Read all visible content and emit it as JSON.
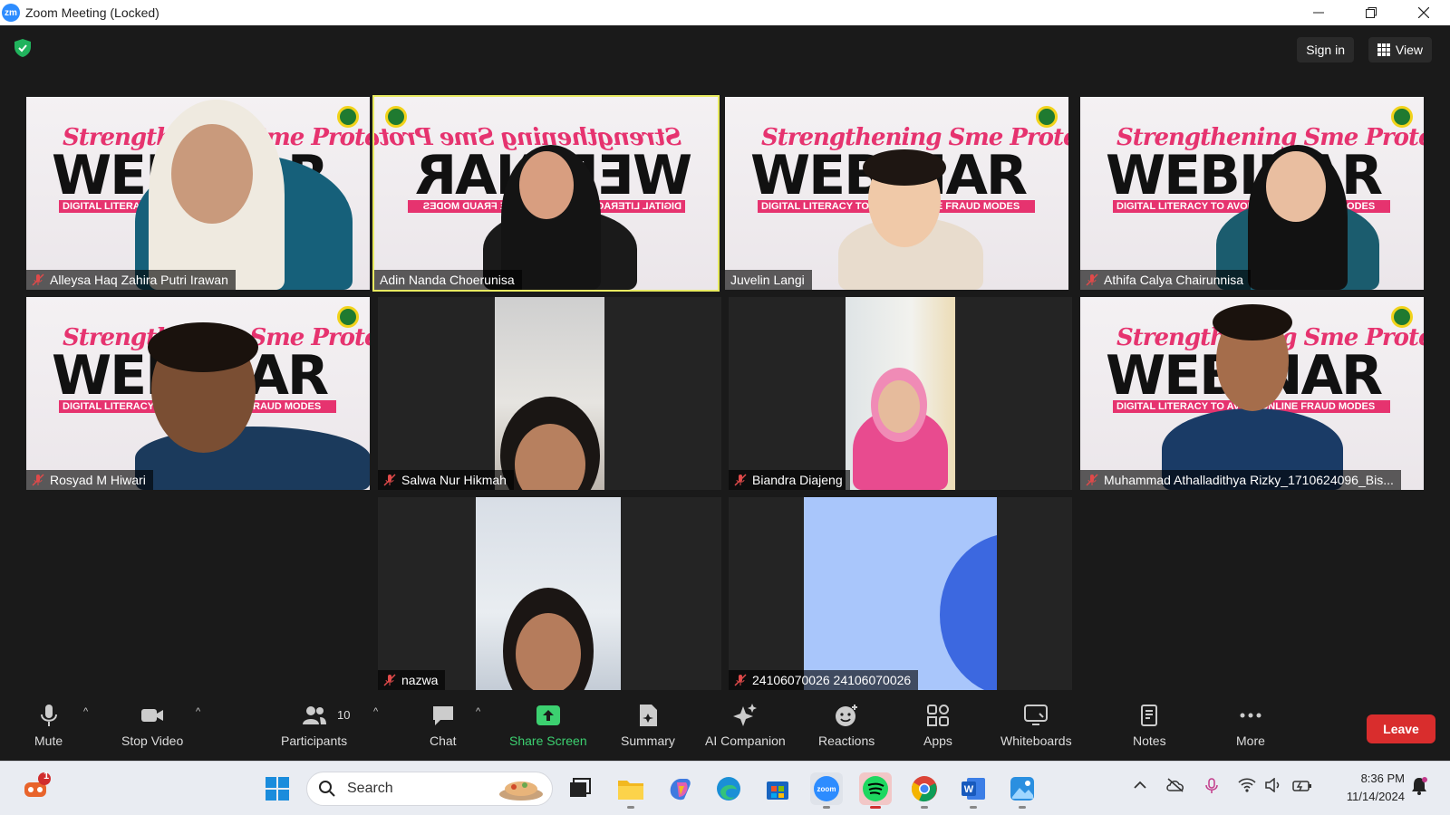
{
  "window": {
    "title": "Zoom Meeting (Locked)",
    "app_badge": "zm"
  },
  "topbar": {
    "sign_in": "Sign in",
    "view": "View"
  },
  "slide": {
    "script": "Strengthening Sme Protection",
    "big": "WEBINAR",
    "band": "DIGITAL LITERACY TO AVOID ONLINE FRAUD MODES"
  },
  "participants": [
    {
      "name": "Alleysa Haq Zahira Putri Irawan",
      "muted": true,
      "active": false
    },
    {
      "name": "Adin Nanda Choerunisa",
      "muted": false,
      "active": true
    },
    {
      "name": "Juvelin Langi",
      "muted": false,
      "active": false
    },
    {
      "name": "Athifa Calya Chairunnisa",
      "muted": true,
      "active": false
    },
    {
      "name": "Rosyad M Hiwari",
      "muted": true,
      "active": false
    },
    {
      "name": "Salwa Nur Hikmah",
      "muted": true,
      "active": false
    },
    {
      "name": "Biandra Diajeng",
      "muted": true,
      "active": false
    },
    {
      "name": "Muhammad Athalladithya Rizky_1710624096_Bis...",
      "muted": true,
      "active": false
    },
    {
      "name": "nazwa",
      "muted": true,
      "active": false
    },
    {
      "name": "24106070026 24106070026",
      "muted": true,
      "active": false
    }
  ],
  "toolbar": {
    "mute": "Mute",
    "stop_video": "Stop Video",
    "participants": "Participants",
    "participant_count": "10",
    "chat": "Chat",
    "share_screen": "Share Screen",
    "summary": "Summary",
    "ai_companion": "AI Companion",
    "reactions": "Reactions",
    "apps": "Apps",
    "whiteboards": "Whiteboards",
    "notes": "Notes",
    "more": "More",
    "leave": "Leave"
  },
  "taskbar": {
    "search_placeholder": "Search",
    "notification_badge": "1",
    "time": "8:36 PM",
    "date": "11/14/2024"
  },
  "colors": {
    "active_speaker": "#e8ea60",
    "share_green": "#3cd070",
    "leave_red": "#d92d2d",
    "slide_pink": "#e6336f"
  }
}
